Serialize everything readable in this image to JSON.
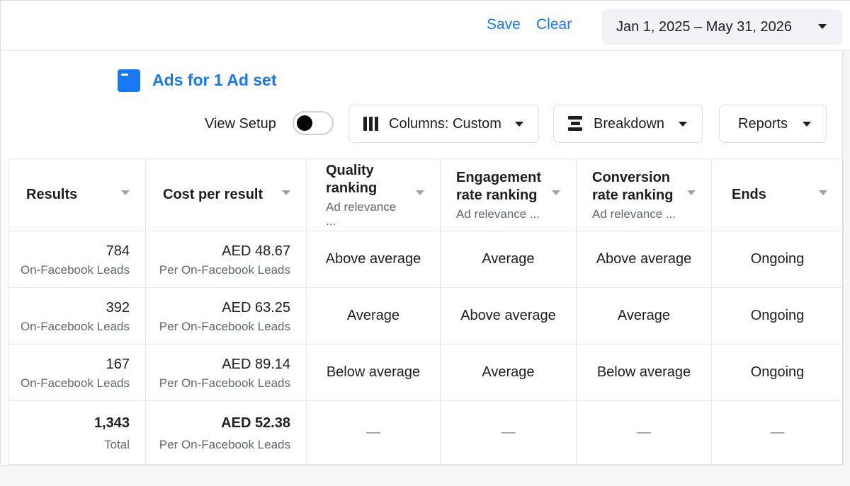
{
  "toolbar": {
    "save_label": "Save",
    "clear_label": "Clear",
    "date_range": "Jan 1, 2025 – May 31, 2026"
  },
  "header": {
    "title": "Ads for 1 Ad set",
    "view_setup_label": "View Setup",
    "view_setup_on": false,
    "columns_label": "Columns: Custom",
    "breakdown_label": "Breakdown",
    "reports_label": "Reports"
  },
  "table": {
    "columns": [
      {
        "main": "Results",
        "sub": ""
      },
      {
        "main": "Cost per result",
        "sub": ""
      },
      {
        "main": "Quality ranking",
        "sub": "Ad relevance ..."
      },
      {
        "main": "Engagement rate ranking",
        "sub": "Ad relevance ..."
      },
      {
        "main": "Conversion rate ranking",
        "sub": "Ad relevance ..."
      },
      {
        "main": "Ends",
        "sub": ""
      }
    ],
    "rows": [
      {
        "results": "784",
        "results_sub": "On-Facebook Leads",
        "cost": "AED 48.67",
        "cost_sub": "Per On-Facebook Leads",
        "quality": "Above average",
        "engagement": "Average",
        "conversion": "Above average",
        "ends": "Ongoing"
      },
      {
        "results": "392",
        "results_sub": "On-Facebook Leads",
        "cost": "AED 63.25",
        "cost_sub": "Per On-Facebook Leads",
        "quality": "Average",
        "engagement": "Above average",
        "conversion": "Average",
        "ends": "Ongoing"
      },
      {
        "results": "167",
        "results_sub": "On-Facebook Leads",
        "cost": "AED 89.14",
        "cost_sub": "Per On-Facebook Leads",
        "quality": "Below average",
        "engagement": "Average",
        "conversion": "Below average",
        "ends": "Ongoing"
      }
    ],
    "total": {
      "results": "1,343",
      "results_sub": "Total",
      "cost": "AED 52.38",
      "cost_sub": "Per On-Facebook Leads",
      "quality": "—",
      "engagement": "—",
      "conversion": "—",
      "ends": "—"
    }
  },
  "colors": {
    "accent": "#1877f2",
    "text": "#1c1e21",
    "muted": "#606770",
    "border": "#e4e6eb"
  },
  "icons": {
    "adset": "ad-set-icon",
    "columns": "columns-icon",
    "breakdown": "breakdown-icon",
    "dropdown": "chevron-down-icon",
    "sort": "sort-caret-icon"
  }
}
